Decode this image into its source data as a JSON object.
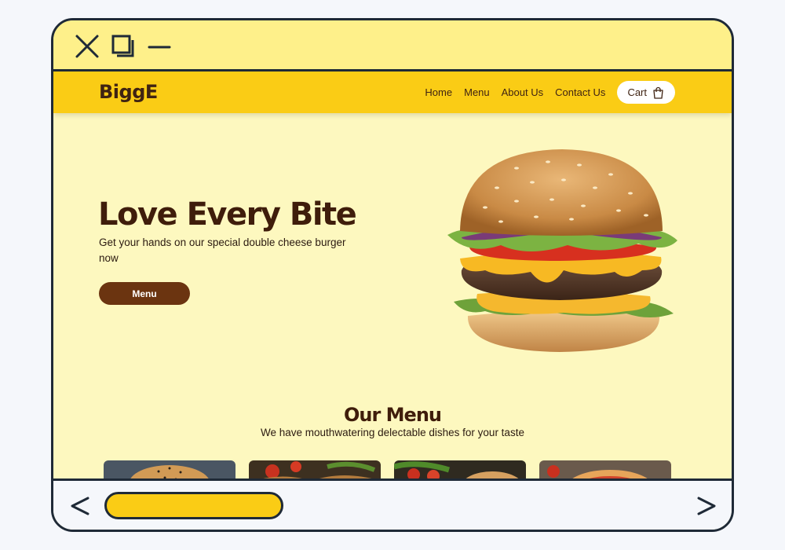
{
  "window": {
    "close_icon": "close-icon",
    "restore_icon": "restore-icon",
    "minimize_icon": "minimize-icon"
  },
  "nav": {
    "logo": "BiggE",
    "links": [
      "Home",
      "Menu",
      "About Us",
      "Contact Us"
    ],
    "cart_label": "Cart",
    "cart_icon": "shopping-bag-icon"
  },
  "hero": {
    "title": "Love Every Bite",
    "subtitle": "Get your hands on our special double cheese burger now",
    "button_label": "Menu"
  },
  "menu_section": {
    "title": "Our Menu",
    "subtitle": "We have mouthwatering delectable dishes for your taste"
  },
  "colors": {
    "accent": "#facc15",
    "background": "#fdf8bf",
    "brown": "#6b3410",
    "text_dark": "#3f1d0b"
  },
  "bottom_bar": {
    "back_icon": "chevron-left-icon",
    "forward_icon": "chevron-right-icon"
  }
}
